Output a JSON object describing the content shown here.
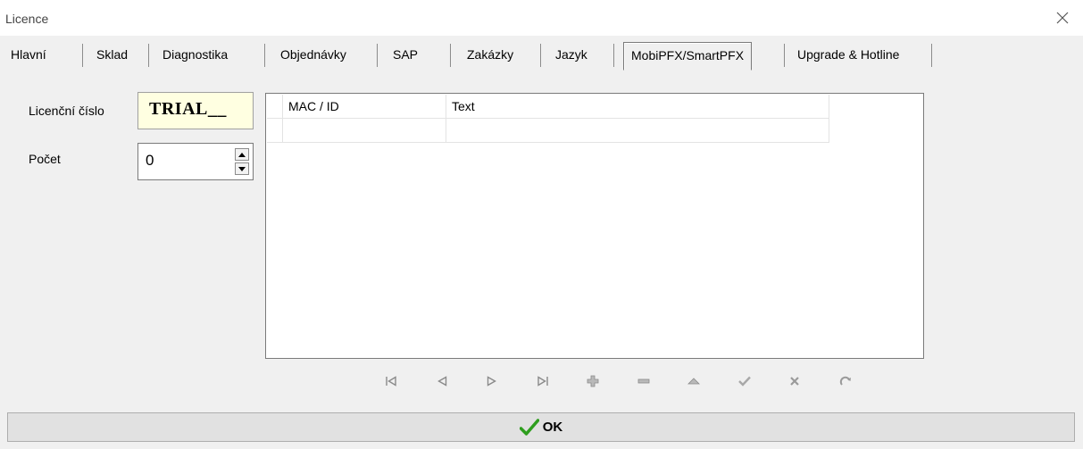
{
  "window": {
    "title": "Licence"
  },
  "tabs": [
    {
      "label": "Hlavní"
    },
    {
      "label": "Sklad"
    },
    {
      "label": "Diagnostika"
    },
    {
      "label": "Objednávky"
    },
    {
      "label": "SAP"
    },
    {
      "label": "Zakázky"
    },
    {
      "label": "Jazyk"
    },
    {
      "label": "MobiPFX/SmartPFX",
      "active": true
    },
    {
      "label": "Upgrade & Hotline"
    }
  ],
  "form": {
    "licence_label": "Licenční číslo",
    "licence_value": "TRIAL__",
    "count_label": "Počet",
    "count_value": "0"
  },
  "grid": {
    "columns": [
      "MAC / ID",
      "Text"
    ],
    "rows": [
      [
        "",
        ""
      ]
    ]
  },
  "navigator": {
    "buttons": [
      "first-icon",
      "prior-icon",
      "next-icon",
      "last-icon",
      "insert-icon",
      "delete-icon",
      "edit-icon",
      "post-icon",
      "cancel-icon",
      "refresh-icon"
    ]
  },
  "ok_button": {
    "label": "OK"
  },
  "colors": {
    "check_green": "#2e9e1e",
    "licence_bg": "#ffffe1"
  }
}
